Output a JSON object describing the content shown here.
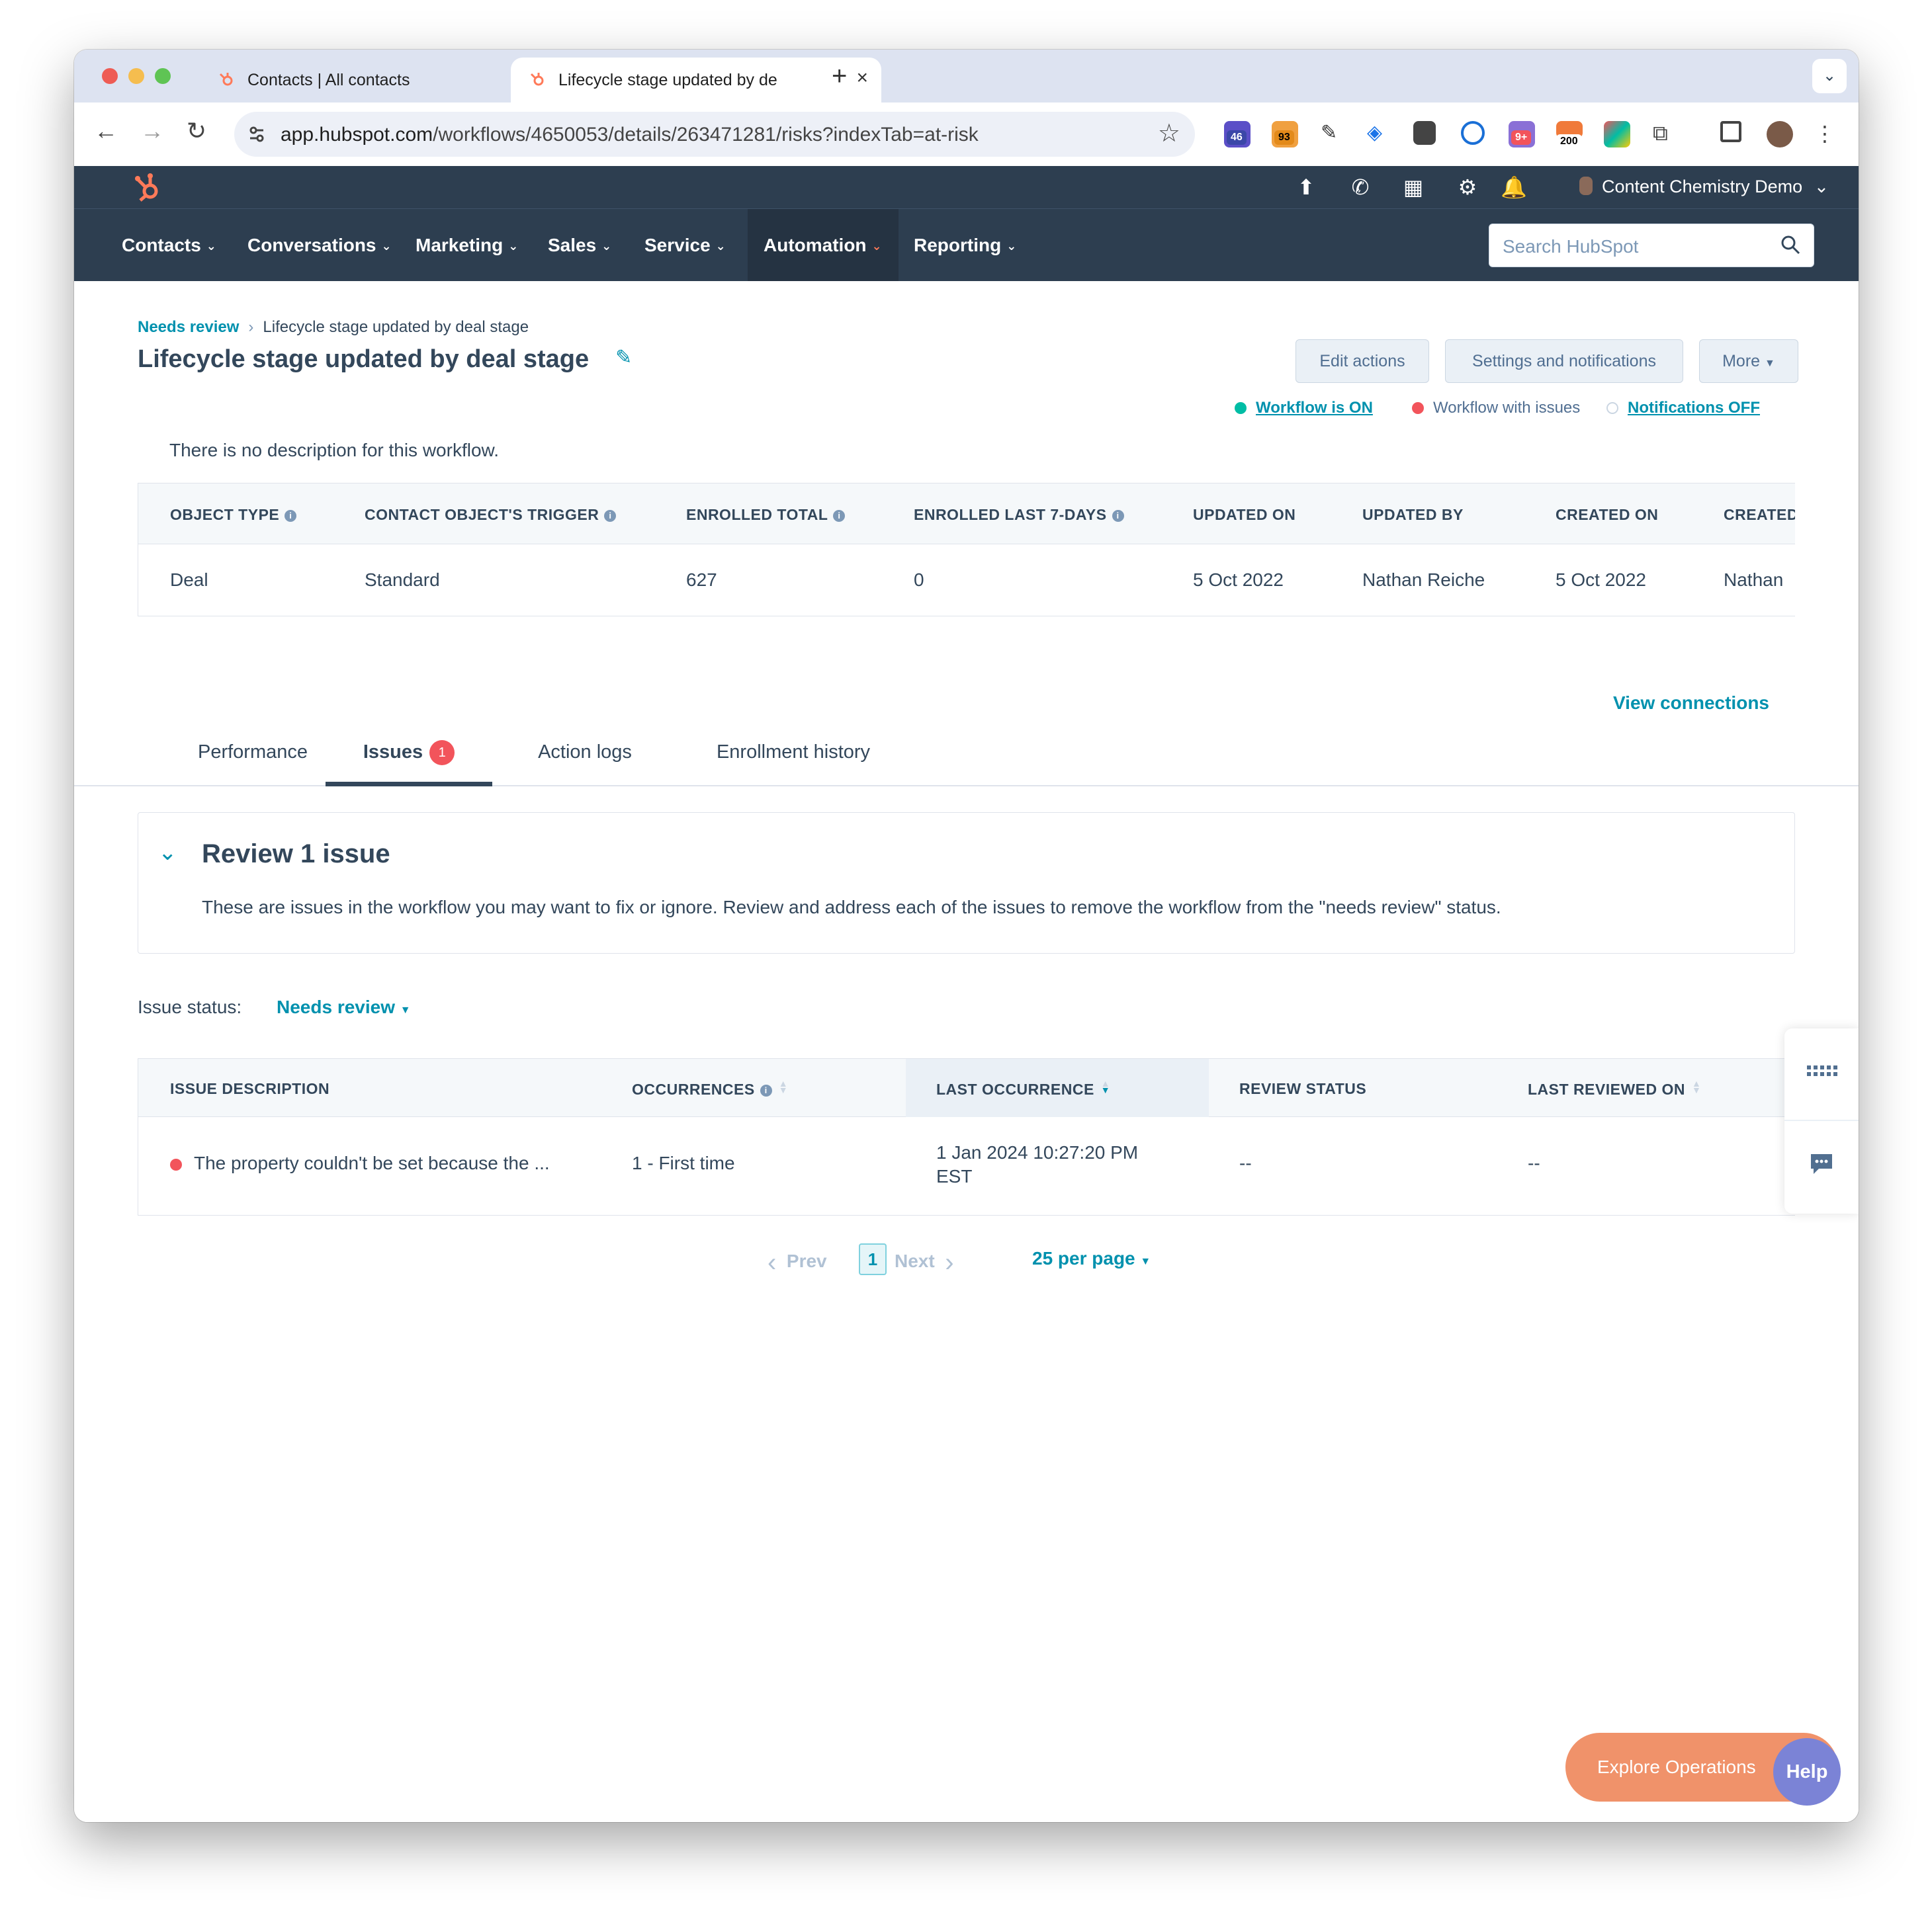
{
  "browser": {
    "tabs": [
      {
        "title": "Contacts | All contacts",
        "active": false
      },
      {
        "title": "Lifecycle stage updated by de",
        "active": true
      }
    ],
    "url_host": "app.hubspot.com",
    "url_path": "/workflows/4650053/details/263471281/risks?indexTab=at-risk",
    "extension_badges": [
      "46",
      "93",
      "9+",
      "200"
    ]
  },
  "topbar": {
    "account_name": "Content Chemistry Demo",
    "icons": [
      "upgrade-icon",
      "calling-icon",
      "marketplace-icon",
      "settings-icon",
      "notifications-icon"
    ]
  },
  "nav": {
    "items": [
      "Contacts",
      "Conversations",
      "Marketing",
      "Sales",
      "Service",
      "Automation",
      "Reporting"
    ],
    "active": "Automation",
    "search_placeholder": "Search HubSpot"
  },
  "page": {
    "breadcrumb_parent": "Needs review",
    "breadcrumb_current": "Lifecycle stage updated by deal stage",
    "title": "Lifecycle stage updated by deal stage",
    "buttons": {
      "edit_actions": "Edit actions",
      "settings": "Settings and notifications",
      "more": "More"
    },
    "status": {
      "workflow_on": "Workflow is ON",
      "with_issues": "Workflow with issues",
      "notifications": "Notifications OFF"
    },
    "description": "There is no description for this workflow."
  },
  "details": {
    "headers": [
      "OBJECT TYPE",
      "CONTACT OBJECT'S TRIGGER",
      "ENROLLED TOTAL",
      "ENROLLED LAST 7-DAYS",
      "UPDATED ON",
      "UPDATED BY",
      "CREATED ON",
      "CREATED"
    ],
    "values": [
      "Deal",
      "Standard",
      "627",
      "0",
      "5 Oct 2022",
      "Nathan Reiche",
      "5 Oct 2022",
      "Nathan"
    ]
  },
  "view_connections": "View connections",
  "tabs": {
    "performance": "Performance",
    "issues": "Issues",
    "issues_count": "1",
    "action_logs": "Action logs",
    "enrollment_history": "Enrollment history"
  },
  "review": {
    "title": "Review 1 issue",
    "description": "These are issues in the workflow you may want to fix or ignore. Review and address each of the issues to remove the workflow from the \"needs review\" status."
  },
  "issue_status": {
    "label": "Issue status:",
    "value": "Needs review"
  },
  "issues_table": {
    "headers": [
      "ISSUE DESCRIPTION",
      "OCCURRENCES",
      "LAST OCCURRENCE",
      "REVIEW STATUS",
      "LAST REVIEWED ON"
    ],
    "rows": [
      {
        "description": "The property couldn't be set because the ...",
        "occurrences": "1 - First time",
        "last_occurrence_1": "1 Jan 2024 10:27:20 PM",
        "last_occurrence_2": "EST",
        "review_status": "--",
        "last_reviewed": "--"
      }
    ]
  },
  "pagination": {
    "prev": "Prev",
    "page": "1",
    "next": "Next",
    "per_page": "25 per page"
  },
  "floating": {
    "explore": "Explore Operations",
    "help": "Help"
  },
  "colors": {
    "nav_bg": "#2d3e50",
    "link": "#0091ae",
    "accent": "#ff7a59",
    "on": "#00bda5",
    "issue": "#f2545b"
  }
}
